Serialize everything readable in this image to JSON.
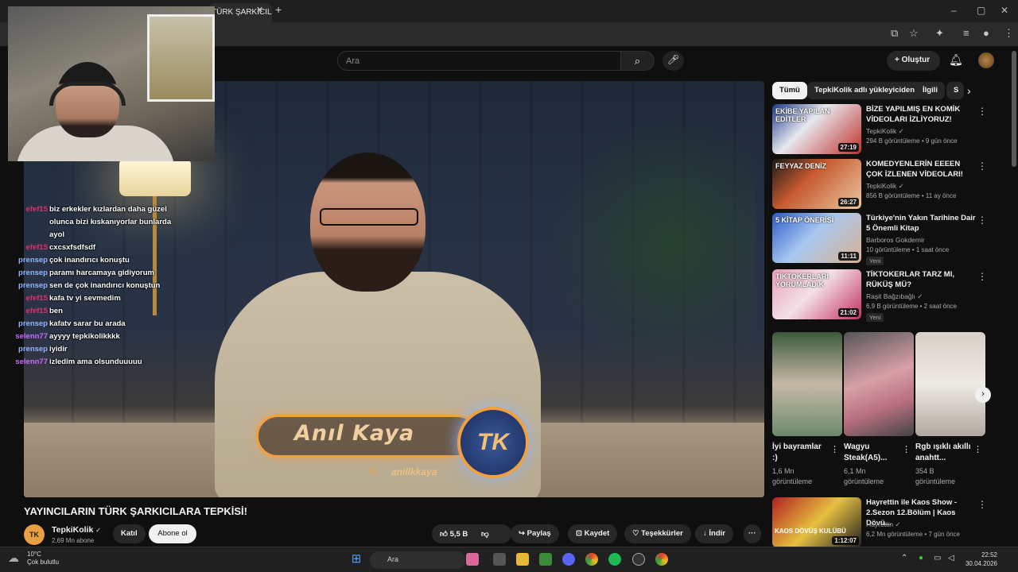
{
  "browser": {
    "tab_title": "TÜRK ŞARKICILA",
    "tab_close": "✕",
    "new_tab": "+",
    "window_controls": [
      "–",
      "▢",
      "✕"
    ]
  },
  "youtube": {
    "search_placeholder": "Ara",
    "search_icon": "search-icon",
    "create_label": "Oluştur",
    "create_plus": "+"
  },
  "video": {
    "lower_third_name": "Anıl Kaya",
    "logo_text": "TK",
    "instagram_handle": "anillkkaya",
    "title": "YAYINCILARIN TÜRK ŞARKICILARA TEPKİSİ!"
  },
  "channel": {
    "avatar_text": "TK",
    "name": "TepkiKolik",
    "verified": "✓",
    "subscribers": "2,69 Mn abone",
    "join_label": "Katıl",
    "subscribe_label": "Abone ol"
  },
  "actions": {
    "likes": "5,5 B",
    "share": "Paylaş",
    "save": "Kaydet",
    "thanks": "Teşekkürler",
    "download": "İndir",
    "more": "···"
  },
  "chat": [
    {
      "user": "efef15",
      "msg": "biz erkekler kızlardan daha güzel",
      "color": "#e0306a"
    },
    {
      "user": "",
      "msg": "olunca bizi kıskanıyorlar bunlarda",
      "color": "#e0306a"
    },
    {
      "user": "",
      "msg": "ayol",
      "color": "#e0306a"
    },
    {
      "user": "efef15",
      "msg": "cxcsxfsdfsdf",
      "color": "#e0306a"
    },
    {
      "user": "prensep",
      "msg": "çok inandırıcı konuştu",
      "color": "#8fb4ff"
    },
    {
      "user": "prensep",
      "msg": "paramı harcamaya gidiyorum",
      "color": "#8fb4ff"
    },
    {
      "user": "prensep",
      "msg": "sen de çok inandırıcı konuştun",
      "color": "#8fb4ff"
    },
    {
      "user": "efef15",
      "msg": "kafa tv yi sevmedim",
      "color": "#e0306a"
    },
    {
      "user": "efef15",
      "msg": "ben",
      "color": "#e0306a"
    },
    {
      "user": "prensep",
      "msg": "kafatv sarar bu arada",
      "color": "#8fb4ff"
    },
    {
      "user": "selenn77",
      "msg": "ayyyy tepkikolikkkk",
      "color": "#c86cff"
    },
    {
      "user": "prensep",
      "msg": "iyidir",
      "color": "#8fb4ff"
    },
    {
      "user": "selenn77",
      "msg": "izledim ama olsunduuuuu",
      "color": "#c86cff"
    }
  ],
  "sidebar": {
    "chips": [
      "Tümü",
      "TepkiKolik adlı yükleyiciden",
      "İlgili",
      "S"
    ],
    "related": [
      {
        "title": "BİZE YAPILMIŞ EN KOMİK VİDEOLARI İZLİYORUZ!",
        "channel": "TepkiKolik",
        "verified": "✓",
        "meta": "294 B görüntüleme • 9 gün önce",
        "duration": "27:19",
        "new": "",
        "thumb_text": "EKİBE YAPILAN EDİTLER"
      },
      {
        "title": "KOMEDYENLERİN EEEEN ÇOK İZLENEN VİDEOLARI!",
        "channel": "TepkiKolik",
        "verified": "✓",
        "meta": "856 B görüntüleme • 11 ay önce",
        "duration": "26:27",
        "new": "",
        "thumb_text": "FEYYAZ  DENİZ"
      },
      {
        "title": "Türkiye'nin Yakın Tarihine Dair 5 Önemli Kitap",
        "channel": "Barboros Gokdemir",
        "verified": "",
        "meta": "10 görüntüleme • 1 saat önce",
        "duration": "11:11",
        "new": "Yeni",
        "thumb_text": "5 KİTAP ÖNERİSİ"
      },
      {
        "title": "TİKTOKERLAR TARZ MI, RÜKÜŞ MÜ?",
        "channel": "Raşit Bağzıbağlı",
        "verified": "✓",
        "meta": "6,9 B görüntüleme • 2 saat önce",
        "duration": "21:02",
        "new": "Yeni",
        "thumb_text": "TİKTOKERLARI YORUMLADIK"
      }
    ],
    "shorts": [
      {
        "title": "İyi bayramlar :)",
        "meta1": "1,6 Mn",
        "meta2": "görüntüleme"
      },
      {
        "title": "Wagyu Steak(A5)...",
        "meta1": "6,1 Mn",
        "meta2": "görüntüleme"
      },
      {
        "title": "Rgb ışıklı akıllı anahtt...",
        "meta1": "354 B",
        "meta2": "görüntüleme"
      }
    ],
    "last": {
      "title": "Hayrettin ile Kaos Show - 2.Sezon 12.Bölüm | Kaos Dövü...",
      "channel": "Hayrettin",
      "verified": "✓",
      "meta": "6,2 Mn görüntüleme • 7 gün önce",
      "duration": "1:12:07",
      "thumb_text": "KAOS DÖVÜŞ KULÜBÜ"
    }
  },
  "taskbar": {
    "weather_temp": "10°C",
    "weather_desc": "Çok bulutlu",
    "search_label": "Ara",
    "time": "22:52",
    "date": "30.04.2026"
  },
  "colors": {
    "accent": "#f0a040",
    "subscribe_bg": "#f1f1f1",
    "bg": "#0f0f0f"
  }
}
